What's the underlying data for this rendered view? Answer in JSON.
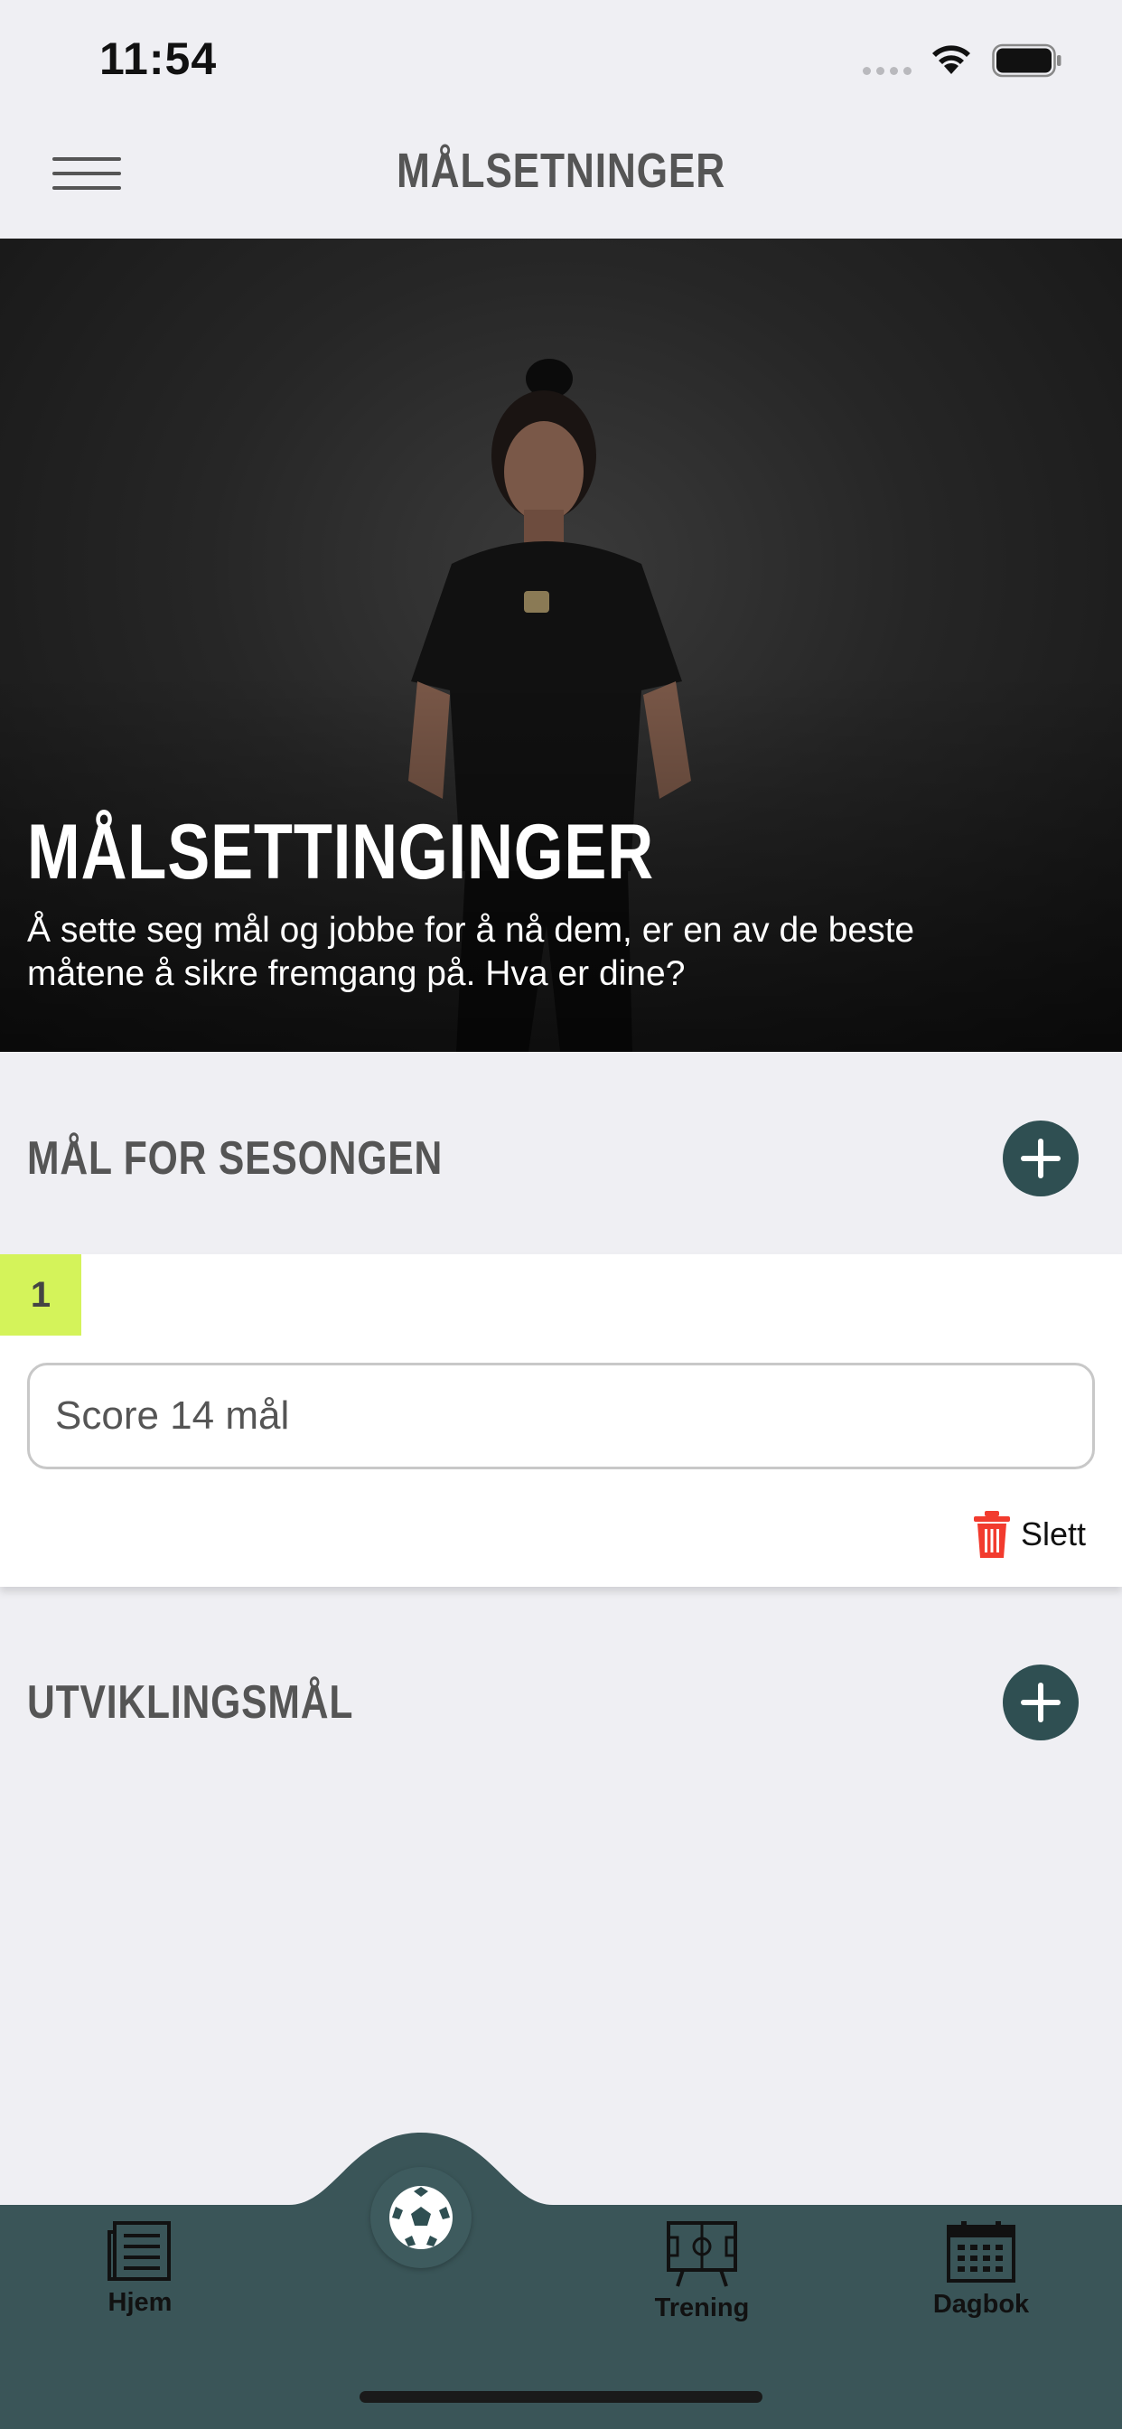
{
  "status_bar": {
    "time": "11:54"
  },
  "nav": {
    "title": "MÅLSETNINGER",
    "menu_icon": "hamburger-menu-icon"
  },
  "hero": {
    "title": "MÅLSETTINGINGER",
    "text": "Å sette seg mål og jobbe for å nå dem, er en av de beste måtene å sikre fremgang på. Hva er dine?"
  },
  "season_goals": {
    "title": "MÅL FOR SESONGEN",
    "add_icon": "plus-icon",
    "items": [
      {
        "number": "1",
        "value": "Score 14 mål",
        "delete_label": "Slett",
        "delete_icon": "trash-icon"
      }
    ]
  },
  "development_goals": {
    "title": "UTVIKLINGSMÅL",
    "add_icon": "plus-icon"
  },
  "tab_bar": {
    "items": [
      {
        "label": "Hjem",
        "icon": "newspaper-icon"
      },
      {
        "label": "",
        "icon": "football-icon"
      },
      {
        "label": "Trening",
        "icon": "tactics-board-icon"
      },
      {
        "label": "Dagbok",
        "icon": "calendar-icon"
      }
    ]
  },
  "colors": {
    "background": "#efeff3",
    "accent_dark": "#2f4f52",
    "tab_bar": "#3a5558",
    "number_badge": "#d4f35a",
    "delete_red": "#f23b2e"
  }
}
